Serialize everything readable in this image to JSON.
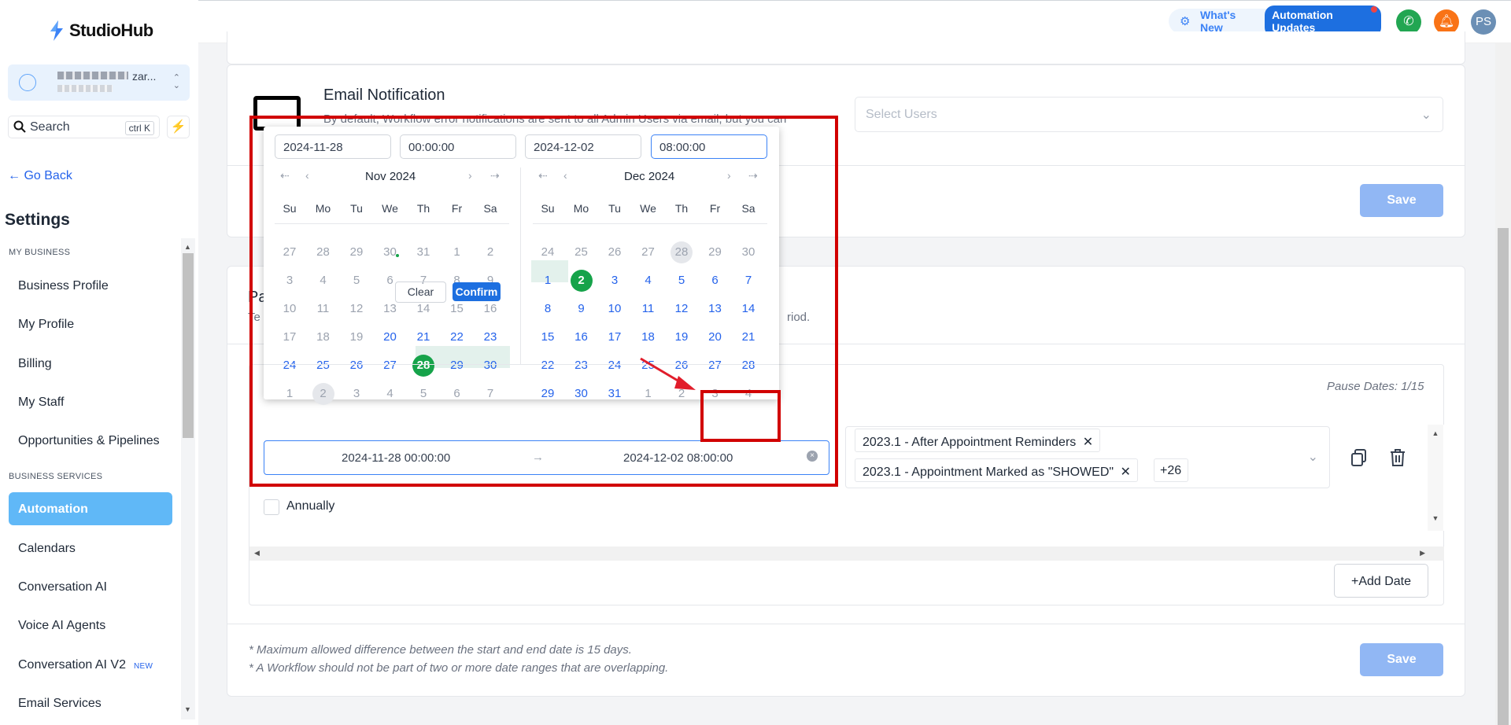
{
  "brand": {
    "name": "StudioHub"
  },
  "account": {
    "name": "zar..."
  },
  "search": {
    "label": "Search",
    "shortcut": "ctrl K"
  },
  "nav": {
    "go_back": "Go Back",
    "title": "Settings",
    "sections": [
      {
        "label": "MY BUSINESS",
        "items": [
          "Business Profile",
          "My Profile",
          "Billing",
          "My Staff",
          "Opportunities & Pipelines"
        ]
      },
      {
        "label": "BUSINESS SERVICES",
        "items": [
          "Automation",
          "Calendars",
          "Conversation AI",
          "Voice AI Agents",
          "Conversation AI V2",
          "Email Services"
        ]
      }
    ],
    "new_badge": "NEW",
    "active": "Automation"
  },
  "topbar": {
    "whats_new": "What's New",
    "automation_updates": "Automation Updates",
    "avatar": "PS"
  },
  "email_notification": {
    "title": "Email Notification",
    "description": "By default, Workflow error notifications are sent to all Admin Users via email, but you can",
    "select_placeholder": "Select Users",
    "save": "Save"
  },
  "pause": {
    "title_partial": "Pa",
    "desc_partial_left": "Te",
    "desc_partial_right": "riod.",
    "pause_dates": "Pause Dates: 1/15",
    "range_start": "2024-11-28 00:00:00",
    "range_end": "2024-12-02 08:00:00",
    "arrow": "→",
    "annually": "Annually",
    "tags": [
      "2023.1 - After Appointment Reminders",
      "2023.1 - Appointment Marked as \"SHOWED\""
    ],
    "more": "+26",
    "add_date": "Add Date",
    "notes": [
      "* Maximum allowed difference between the start and end date is 15 days.",
      "* A Workflow should not be part of two or more date ranges that are overlapping."
    ],
    "save": "Save"
  },
  "picker": {
    "start_date": "2024-11-28",
    "start_time": "00:00:00",
    "end_date": "2024-12-02",
    "end_time": "08:00:00",
    "left_month": "Nov 2024",
    "right_month": "Dec 2024",
    "weekdays": [
      "Su",
      "Mo",
      "Tu",
      "We",
      "Th",
      "Fr",
      "Sa"
    ],
    "left_days": [
      [
        "27",
        "28",
        "29",
        "30",
        "31",
        "1",
        "2"
      ],
      [
        "3",
        "4",
        "5",
        "6",
        "7",
        "8",
        "9"
      ],
      [
        "10",
        "11",
        "12",
        "13",
        "14",
        "15",
        "16"
      ],
      [
        "17",
        "18",
        "19",
        "20",
        "21",
        "22",
        "23"
      ],
      [
        "24",
        "25",
        "26",
        "27",
        "28",
        "29",
        "30"
      ],
      [
        "1",
        "2",
        "3",
        "4",
        "5",
        "6",
        "7"
      ]
    ],
    "right_days": [
      [
        "24",
        "25",
        "26",
        "27",
        "28",
        "29",
        "30"
      ],
      [
        "1",
        "2",
        "3",
        "4",
        "5",
        "6",
        "7"
      ],
      [
        "8",
        "9",
        "10",
        "11",
        "12",
        "13",
        "14"
      ],
      [
        "15",
        "16",
        "17",
        "18",
        "19",
        "20",
        "21"
      ],
      [
        "22",
        "23",
        "24",
        "25",
        "26",
        "27",
        "28"
      ],
      [
        "29",
        "30",
        "31",
        "1",
        "2",
        "3",
        "4"
      ]
    ],
    "clear": "Clear",
    "confirm": "Confirm"
  }
}
